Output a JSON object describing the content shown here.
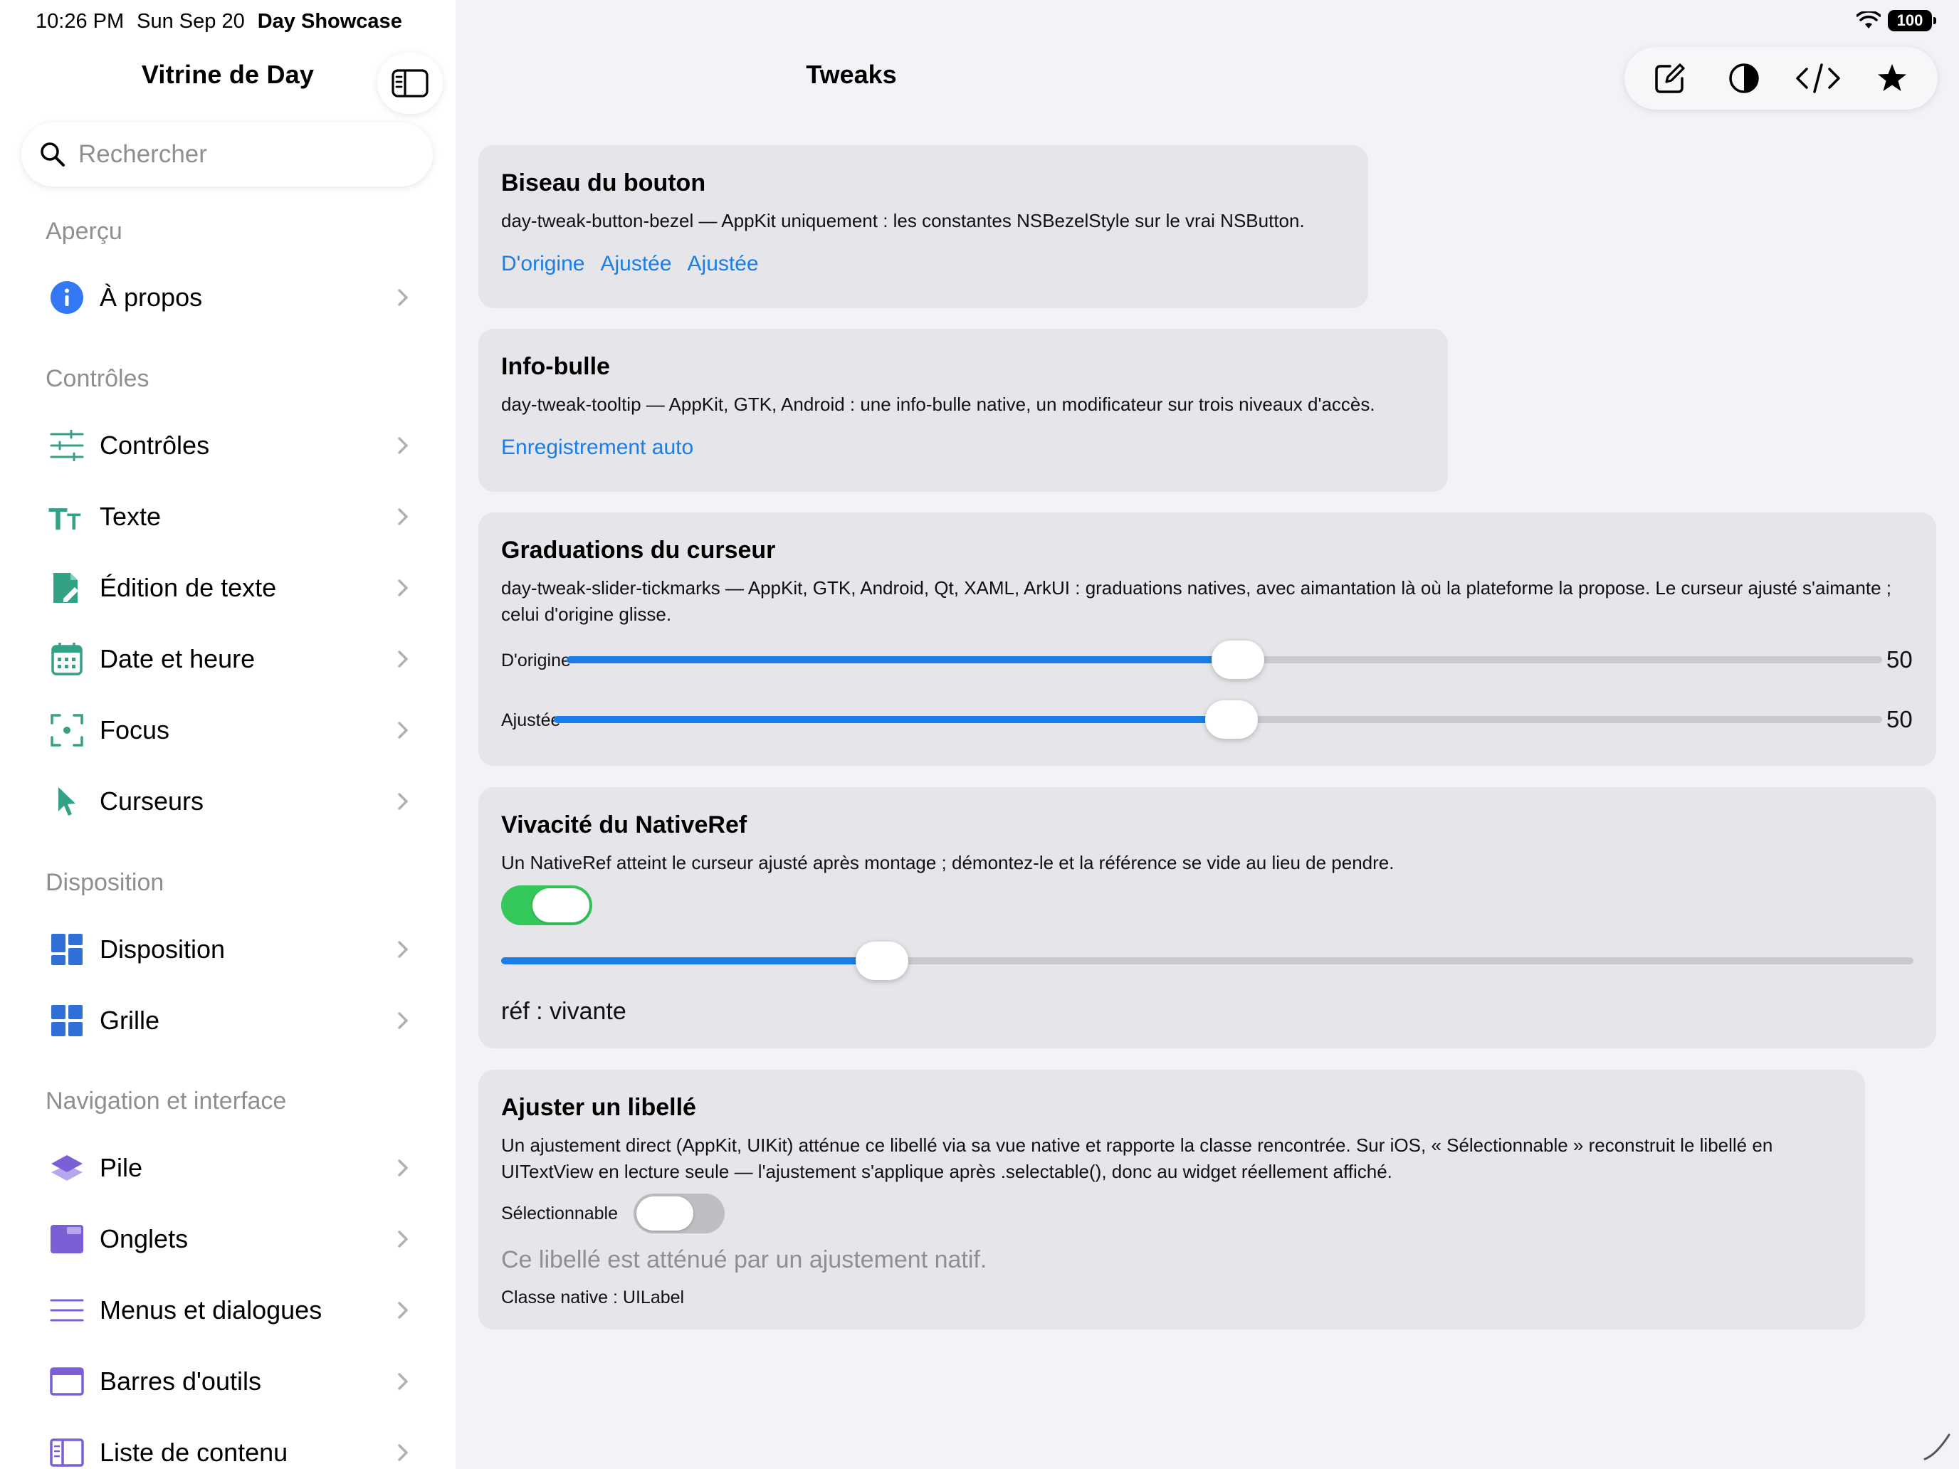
{
  "status": {
    "time": "10:26 PM",
    "date": "Sun Sep 20",
    "app_name": "Day Showcase",
    "battery": "100"
  },
  "sidebar": {
    "title": "Vitrine de Day",
    "search_placeholder": "Rechercher",
    "sections": [
      {
        "header": "Aperçu",
        "items": [
          {
            "label": "À propos",
            "icon": "info-icon",
            "color": "#3478f6"
          }
        ]
      },
      {
        "header": "Contrôles",
        "items": [
          {
            "label": "Contrôles",
            "icon": "sliders-icon",
            "color": "#33a186"
          },
          {
            "label": "Texte",
            "icon": "text-size-icon",
            "color": "#33a186"
          },
          {
            "label": "Édition de texte",
            "icon": "document-edit-icon",
            "color": "#33a186"
          },
          {
            "label": "Date et heure",
            "icon": "calendar-icon",
            "color": "#33a186"
          },
          {
            "label": "Focus",
            "icon": "focus-icon",
            "color": "#33a186"
          },
          {
            "label": "Curseurs",
            "icon": "cursor-icon",
            "color": "#33a186"
          }
        ]
      },
      {
        "header": "Disposition",
        "items": [
          {
            "label": "Disposition",
            "icon": "layout-icon",
            "color": "#2f6fd6"
          },
          {
            "label": "Grille",
            "icon": "grid-icon",
            "color": "#2f6fd6"
          }
        ]
      },
      {
        "header": "Navigation et interface",
        "items": [
          {
            "label": "Pile",
            "icon": "stack-icon",
            "color": "#7b5fd6"
          },
          {
            "label": "Onglets",
            "icon": "tabs-icon",
            "color": "#7b5fd6"
          },
          {
            "label": "Menus et dialogues",
            "icon": "menu-icon",
            "color": "#7b5fd6"
          },
          {
            "label": "Barres d'outils",
            "icon": "toolbar-icon",
            "color": "#7b5fd6"
          },
          {
            "label": "Liste de contenu",
            "icon": "sidebar-list-icon",
            "color": "#7b5fd6"
          }
        ]
      }
    ]
  },
  "main": {
    "title": "Tweaks",
    "toolbar_icons": [
      "compose-icon",
      "contrast-icon",
      "code-icon",
      "star-icon"
    ],
    "accent": "#1a7ee6",
    "cards": {
      "bezel": {
        "title": "Biseau du bouton",
        "desc": "day-tweak-button-bezel — AppKit uniquement : les constantes NSBezelStyle sur le vrai NSButton.",
        "links": [
          "D'origine",
          "Ajustée",
          "Ajustée"
        ]
      },
      "tooltip": {
        "title": "Info-bulle",
        "desc": "day-tweak-tooltip — AppKit, GTK, Android : une info-bulle native, un modificateur sur trois niveaux d'accès.",
        "link": "Enregistrement auto"
      },
      "ticks": {
        "title": "Graduations du curseur",
        "desc": "day-tweak-slider-tickmarks — AppKit, GTK, Android, Qt, XAML, ArkUI : graduations natives, avec aimantation là où la plateforme la propose. Le curseur ajusté s'aimante ; celui d'origine glisse.",
        "sliders": [
          {
            "label": "D'origine",
            "value": "50",
            "fraction": 0.5
          },
          {
            "label": "Ajustée",
            "value": "50",
            "fraction": 0.5
          }
        ]
      },
      "nativeref": {
        "title": "Vivacité du NativeRef",
        "desc": "Un NativeRef atteint le curseur ajusté après montage ; démontez-le et la référence se vide au lieu de pendre.",
        "switch_on": true,
        "slider_fraction": 0.26,
        "status": "réf : vivante"
      },
      "label": {
        "title": "Ajuster un libellé",
        "desc": "Un ajustement direct (AppKit, UIKit) atténue ce libellé via sa vue native et rapporte la classe rencontrée. Sur iOS, « Sélectionnable » reconstruit le libellé en UITextView en lecture seule — l'ajustement s'applique après .selectable(), donc au widget réellement affiché.",
        "switch_label": "Sélectionnable",
        "switch_on": false,
        "dimmed": "Ce libellé est atténué par un ajustement natif.",
        "class_info": "Classe native : UILabel"
      }
    }
  }
}
